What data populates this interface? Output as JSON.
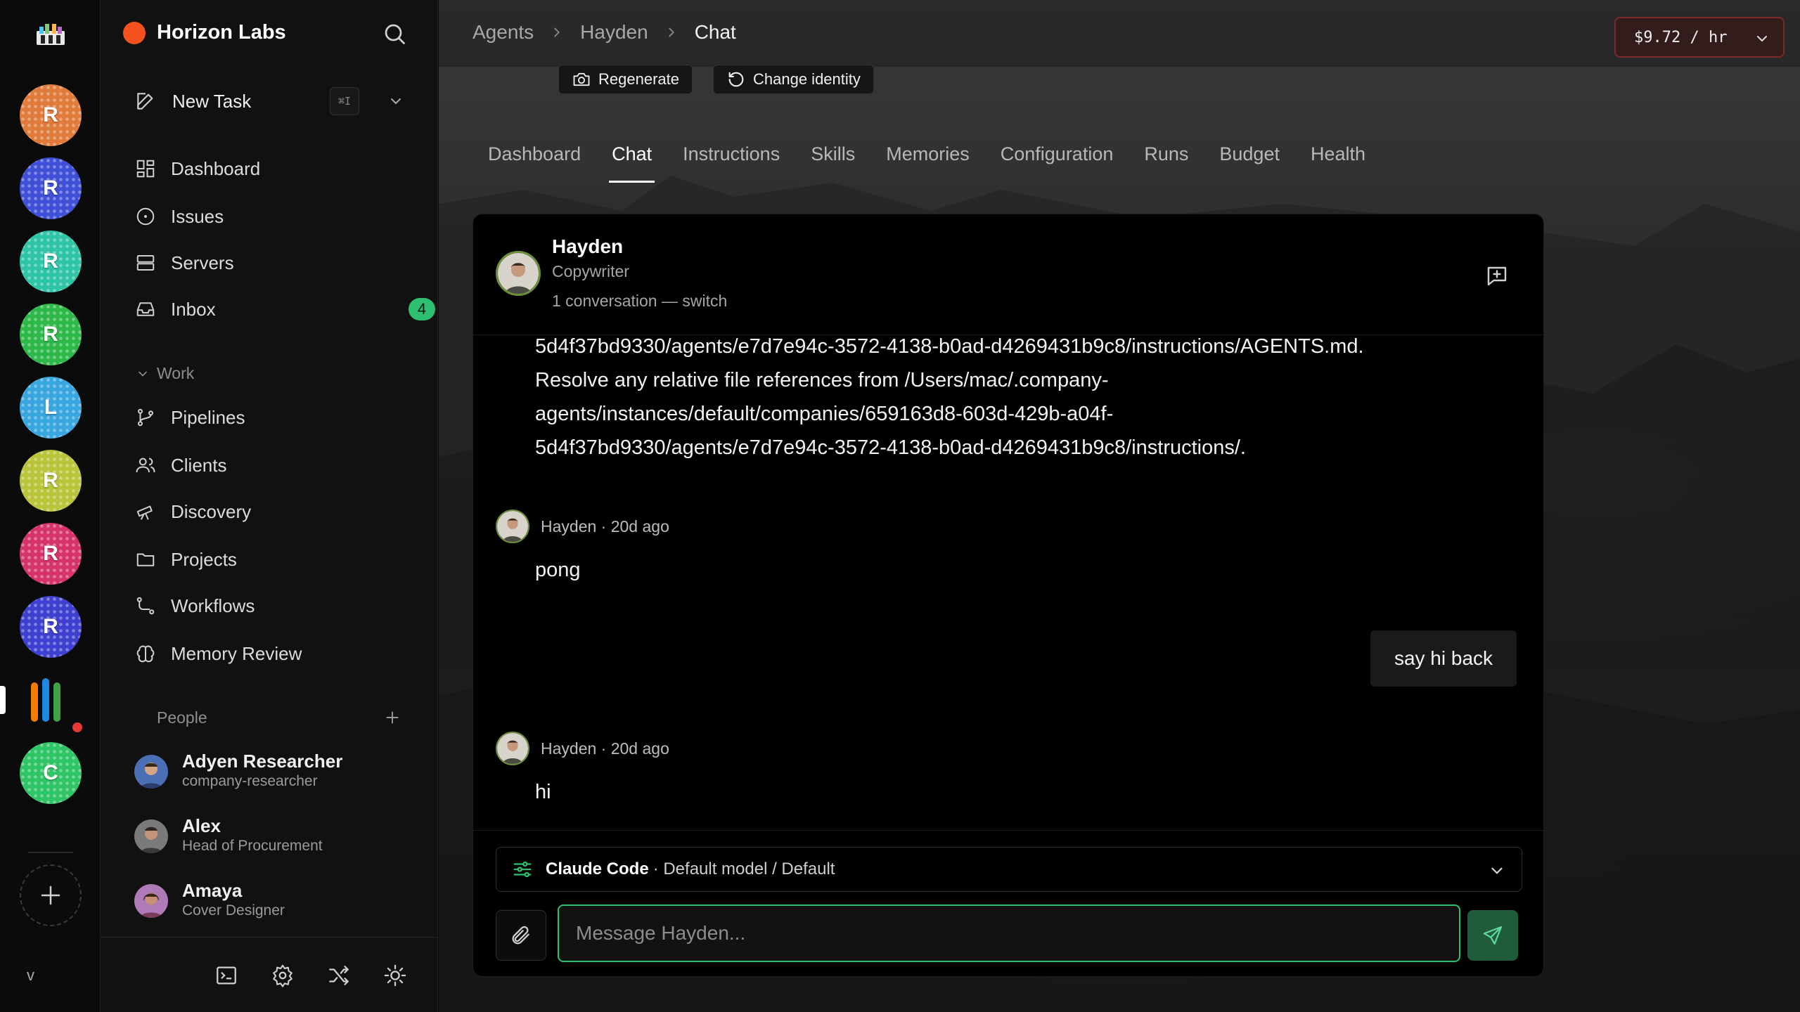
{
  "rail": {
    "workspaces": [
      {
        "letter": "R",
        "color": "#e07b3c"
      },
      {
        "letter": "R",
        "color": "#3f4fd6"
      },
      {
        "letter": "R",
        "color": "#2fc4a6"
      },
      {
        "letter": "R",
        "color": "#2fb84a"
      },
      {
        "letter": "L",
        "color": "#3aa6e0"
      },
      {
        "letter": "R",
        "color": "#b8c43a"
      },
      {
        "letter": "R",
        "color": "#d6336c"
      },
      {
        "letter": "R",
        "color": "#4040d0"
      },
      {
        "letter": "C",
        "color": "#2fc466"
      }
    ],
    "bottom_label": "v"
  },
  "sidebar": {
    "company": "Horizon Labs",
    "new_task": "New Task",
    "new_task_shortcut": "⌘I",
    "nav": [
      {
        "label": "Dashboard",
        "icon": "dashboard-icon"
      },
      {
        "label": "Issues",
        "icon": "issues-icon"
      },
      {
        "label": "Servers",
        "icon": "servers-icon"
      },
      {
        "label": "Inbox",
        "icon": "inbox-icon",
        "badge": "4"
      }
    ],
    "work_section": "Work",
    "work_items": [
      {
        "label": "Pipelines",
        "icon": "pipelines-icon"
      },
      {
        "label": "Clients",
        "icon": "clients-icon"
      },
      {
        "label": "Discovery",
        "icon": "telescope-icon"
      },
      {
        "label": "Projects",
        "icon": "folder-icon"
      },
      {
        "label": "Workflows",
        "icon": "workflow-icon"
      },
      {
        "label": "Memory Review",
        "icon": "brain-icon"
      }
    ],
    "people_section": "People",
    "people": [
      {
        "name": "Adyen Researcher",
        "role": "company-researcher"
      },
      {
        "name": "Alex",
        "role": "Head of Procurement"
      },
      {
        "name": "Amaya",
        "role": "Cover Designer"
      }
    ]
  },
  "header": {
    "breadcrumbs": [
      "Agents",
      "Hayden",
      "Chat"
    ],
    "cost": "$9.72 / hr"
  },
  "actions": {
    "regenerate": "Regenerate",
    "change_identity": "Change identity"
  },
  "tabs": [
    "Dashboard",
    "Chat",
    "Instructions",
    "Skills",
    "Memories",
    "Configuration",
    "Runs",
    "Budget",
    "Health"
  ],
  "active_tab": "Chat",
  "chat": {
    "agent_name": "Hayden",
    "agent_role": "Copywriter",
    "conversation_info": "1 conversation — switch",
    "system_lines": [
      "5d4f37bd9330/agents/e7d7e94c-3572-4138-b0ad-d4269431b9c8/instructions/AGENTS.md.",
      "Resolve any relative file references from /Users/mac/.company-",
      "agents/instances/default/companies/659163d8-603d-429b-a04f-",
      "5d4f37bd9330/agents/e7d7e94c-3572-4138-b0ad-d4269431b9c8/instructions/."
    ],
    "messages": [
      {
        "meta": "Hayden · 20d ago",
        "text": "pong"
      },
      {
        "user_text": "say hi back"
      },
      {
        "meta": "Hayden · 20d ago",
        "text": "hi"
      }
    ],
    "model_provider": "Claude Code",
    "model_detail": "· Default model / Default",
    "input_placeholder": "Message Hayden..."
  }
}
